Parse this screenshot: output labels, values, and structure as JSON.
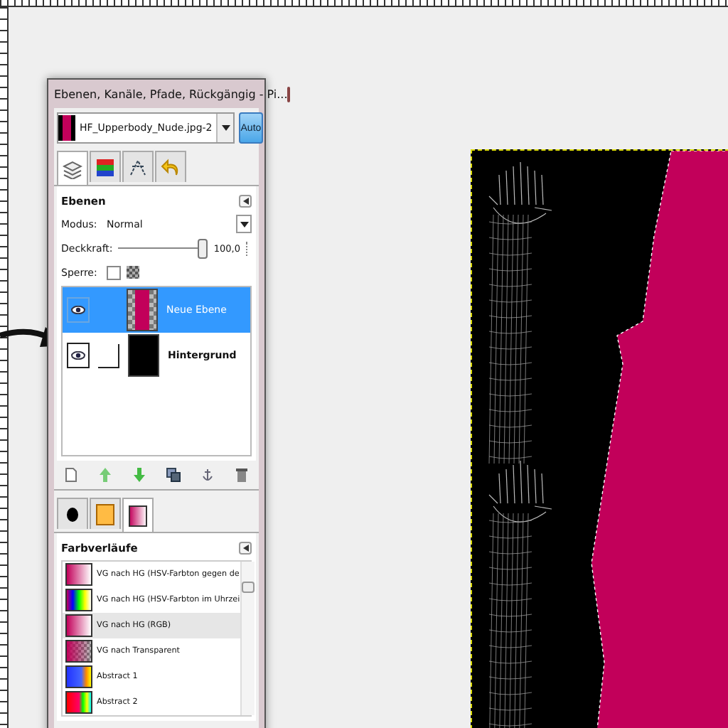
{
  "dock": {
    "title": "Ebenen, Kanäle, Pfade, Rückgängig - Pi...",
    "image_selector": {
      "value": "HF_Upperbody_Nude.jpg-2",
      "auto": {
        "label": "Auto",
        "on": true
      }
    },
    "tabs": [
      {
        "kind": "layers",
        "selected": true
      },
      {
        "kind": "channels",
        "selected": false
      },
      {
        "kind": "paths",
        "selected": false
      },
      {
        "kind": "undo",
        "selected": false
      }
    ],
    "layers_panel": {
      "title": "Ebenen",
      "mode_label": "Modus:",
      "mode_value": "Normal",
      "opacity_label": "Deckkraft:",
      "opacity_value": "100,0",
      "opacity": {
        "level": 1.0
      },
      "lock_label": "Sperre:",
      "lock_checked": false,
      "layers": [
        {
          "name": "Neue Ebene",
          "selected": true,
          "visible": true,
          "bold": false,
          "kind": "transparent"
        },
        {
          "name": "Hintergrund",
          "selected": false,
          "visible": true,
          "bold": true,
          "kind": "filled"
        }
      ]
    },
    "bottom_tabs": [
      {
        "kind": "brush",
        "selected": false
      },
      {
        "kind": "pattern",
        "selected": false
      },
      {
        "kind": "gradient",
        "selected": true
      }
    ],
    "gradients_panel": {
      "title": "Farbverläufe",
      "items": [
        {
          "name": "VG nach HG (HSV-Farbton gegen de",
          "selected": false
        },
        {
          "name": "VG nach HG (HSV-Farbton im Uhrzei",
          "selected": false
        },
        {
          "name": "VG nach HG (RGB)",
          "selected": true
        },
        {
          "name": "VG nach Transparent",
          "selected": false
        },
        {
          "name": "Abstract 1",
          "selected": false
        },
        {
          "name": "Abstract 2",
          "selected": false
        }
      ]
    }
  }
}
